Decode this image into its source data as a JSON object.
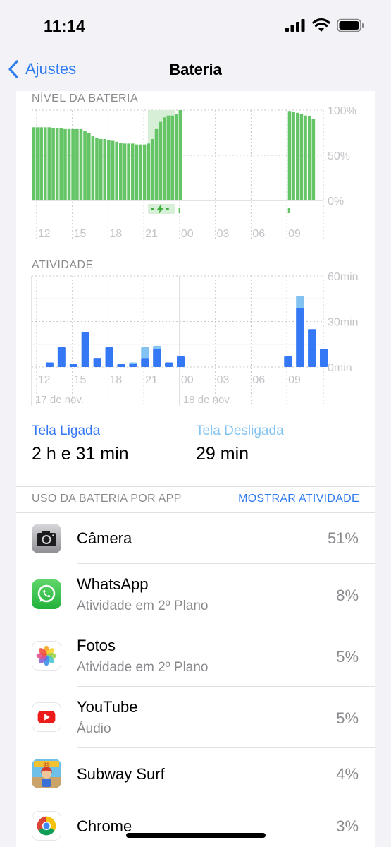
{
  "status_bar": {
    "time": "11:14"
  },
  "nav": {
    "back_label": "Ajustes",
    "title": "Bateria"
  },
  "colors": {
    "accent": "#2f7bf0",
    "battery_green": "#64c466",
    "charging_band": "#d6efd6",
    "screen_on": "#3478f6",
    "screen_off": "#82c3f2",
    "grid": "#c8c8cc",
    "label_gray": "#c4c4c8"
  },
  "battery_level": {
    "section_label": "NÍVEL DA BATERIA",
    "y_ticks": [
      "100%",
      "50%",
      "0%"
    ],
    "x_ticks": [
      "12",
      "15",
      "18",
      "21",
      "00",
      "03",
      "06",
      "09"
    ]
  },
  "activity": {
    "section_label": "ATIVIDADE",
    "y_ticks": [
      "60min",
      "30min",
      "0min"
    ],
    "x_ticks": [
      "12",
      "15",
      "18",
      "21",
      "00",
      "03",
      "06",
      "09"
    ],
    "date_labels": [
      "17 de nov.",
      "18 de nov."
    ]
  },
  "chart_data": [
    {
      "type": "bar",
      "title": "NÍVEL DA BATERIA",
      "xlabel": "",
      "ylabel": "",
      "ylim": [
        0,
        100
      ],
      "x_tick_labels": [
        "12",
        "15",
        "18",
        "21",
        "00",
        "03",
        "06",
        "09"
      ],
      "x_hours": [
        11.0,
        11.33,
        11.67,
        12.0,
        12.33,
        12.67,
        13.0,
        13.33,
        13.67,
        14.0,
        14.33,
        14.67,
        15.0,
        15.33,
        15.67,
        16.0,
        16.33,
        16.67,
        17.0,
        17.33,
        17.67,
        18.0,
        18.33,
        18.67,
        19.0,
        19.33,
        19.67,
        20.0,
        20.33,
        20.67,
        21.0,
        21.33,
        21.67,
        22.0,
        22.33,
        22.67,
        23.0,
        23.33,
        32.5,
        32.83,
        33.17,
        33.5,
        33.83,
        34.17,
        34.5
      ],
      "values": [
        81,
        81,
        81,
        81,
        81,
        80,
        80,
        80,
        79,
        79,
        79,
        79,
        79,
        77,
        75,
        71,
        69,
        68,
        68,
        67,
        66,
        65,
        64,
        63,
        63,
        63,
        62,
        62,
        62,
        63,
        68,
        79,
        87,
        92,
        94,
        94,
        96,
        100,
        99,
        98,
        97,
        96,
        94,
        93,
        90
      ],
      "charging_range_hours": [
        20.75,
        23.0
      ],
      "grid": true
    },
    {
      "type": "bar",
      "title": "ATIVIDADE",
      "xlabel": "",
      "ylabel": "",
      "ylim": [
        0,
        60
      ],
      "y_unit": "min",
      "x_tick_labels": [
        "12",
        "15",
        "18",
        "21",
        "00",
        "03",
        "06",
        "09"
      ],
      "x_hours": [
        12,
        13,
        14,
        15,
        16,
        17,
        18,
        19,
        20,
        21,
        22,
        23,
        32,
        33,
        34,
        35
      ],
      "series": [
        {
          "name": "Tela Ligada",
          "values": [
            3,
            13,
            2,
            23,
            6,
            13,
            2,
            2,
            6,
            12,
            3,
            7,
            7,
            39,
            25,
            12
          ]
        },
        {
          "name": "Tela Desligada",
          "values": [
            0,
            0,
            0,
            0,
            0,
            0,
            0,
            1,
            7,
            2,
            0,
            0,
            0,
            8,
            0,
            0
          ]
        }
      ],
      "grid": true
    }
  ],
  "summary": {
    "on_label": "Tela Ligada",
    "on_value": "2 h e 31 min",
    "off_label": "Tela Desligada",
    "off_value": "29 min"
  },
  "usage": {
    "header": "USO DA BATERIA POR APP",
    "action": "MOSTRAR ATIVIDADE",
    "apps": [
      {
        "name": "Câmera",
        "sub": "",
        "pct": "51%",
        "icon": "camera-icon"
      },
      {
        "name": "WhatsApp",
        "sub": "Atividade em 2º Plano",
        "pct": "8%",
        "icon": "whatsapp-icon"
      },
      {
        "name": "Fotos",
        "sub": "Atividade em 2º Plano",
        "pct": "5%",
        "icon": "photos-icon"
      },
      {
        "name": "YouTube",
        "sub": "Áudio",
        "pct": "5%",
        "icon": "youtube-icon"
      },
      {
        "name": "Subway Surf",
        "sub": "",
        "pct": "4%",
        "icon": "subway-surf-icon"
      },
      {
        "name": "Chrome",
        "sub": "",
        "pct": "3%",
        "icon": "chrome-icon"
      }
    ]
  }
}
